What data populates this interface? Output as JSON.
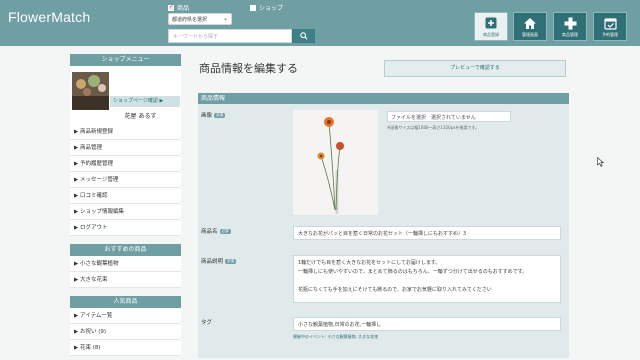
{
  "header": {
    "logo": "FlowerMatch",
    "filters": [
      {
        "label": "商品",
        "checked": true
      },
      {
        "label": "ショップ",
        "checked": false
      }
    ],
    "prefecture_select": "都道府県を選択",
    "search_placeholder": "キーワードから探す",
    "buttons": [
      {
        "label": "商品登録",
        "icon": "plus-box-icon",
        "active": true
      },
      {
        "label": "管理画面",
        "icon": "home-icon",
        "active": false
      },
      {
        "label": "商品管理",
        "icon": "plus-cross-icon",
        "active": false
      },
      {
        "label": "予約管理",
        "icon": "calendar-check-icon",
        "active": false
      }
    ]
  },
  "sidebar": {
    "shop_menu_title": "ショップメニュー",
    "shop_page_link": "ショップページ確認 ▶",
    "shop_name": "花屋 あるす",
    "menu_items": [
      "▶ 商品新規登録",
      "▶ 商品管理",
      "▶ 予約履歴管理",
      "▶ メッセージ管理",
      "▶ 口コミ確認",
      "▶ ショップ情報編集",
      "▶ ログアウト"
    ],
    "recommended_title": "おすすめの商品",
    "recommended_items": [
      "▶ 小さな観葉植物",
      "▶ 大きな花束"
    ],
    "popular_title": "人気商品",
    "popular_items": [
      "▶ アイテム一覧",
      "▶ お祝い (9)",
      "▶ 花束 (8)"
    ]
  },
  "main": {
    "page_title": "商品情報を編集する",
    "preview_button": "プレビューで確認する",
    "section_title": "商品情報",
    "required_badge": "必須",
    "image_label": "画像",
    "file_input": "ファイルを選択　選択されていません",
    "file_note": "※画像サイズは幅1080～高さ1350pxを推奨です。",
    "name_label": "商品名",
    "name_value": "大きなお花がパッと目を惹く日常のお花セット（一輪挿しにもおすすめ）3",
    "description_label": "商品説明",
    "description_lines": [
      "1輪だけでも目を惹く大きなお花をセットにしてお届けします。",
      "一輪挿しにも使いやすいので、まとめて飾るのはもちろん、一輪ずつ分けて出せるのもおすすめです。",
      "",
      "花瓶になくても手を加えにそけても飾るので、お家でお気軽に取り入れてみてください"
    ],
    "tag_label": "タグ",
    "tag_value": "小さな観葉植物,日常のお花,一輪挿し",
    "tag_note": "開催中のイベント: 小さな観葉植物, 大きな花束"
  },
  "colors": {
    "header_bg": "#6f9ea3",
    "button_bg": "#2f6f76",
    "section_bg": "#e0eaea"
  }
}
